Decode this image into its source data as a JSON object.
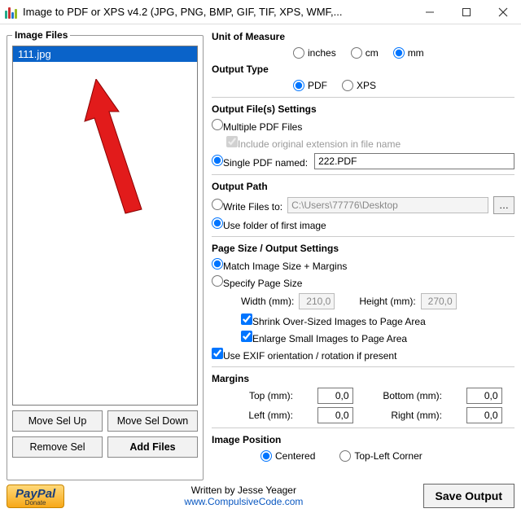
{
  "window": {
    "title": "Image to PDF or XPS  v4.2   (JPG, PNG, BMP, GIF, TIF, XPS, WMF,..."
  },
  "left": {
    "legend": "Image Files",
    "items": [
      "111.jpg"
    ],
    "move_up": "Move Sel Up",
    "move_down": "Move Sel Down",
    "remove": "Remove Sel",
    "add": "Add Files"
  },
  "unit": {
    "legend": "Unit of Measure",
    "inches": "inches",
    "cm": "cm",
    "mm": "mm",
    "selected": "mm"
  },
  "output_type": {
    "legend": "Output Type",
    "pdf": "PDF",
    "xps": "XPS",
    "selected": "PDF"
  },
  "output_files": {
    "legend": "Output File(s) Settings",
    "multiple": "Multiple PDF Files",
    "include_ext": "Include original extension in file name",
    "single": "Single PDF named:",
    "single_value": "222.PDF",
    "selected": "single"
  },
  "output_path": {
    "legend": "Output Path",
    "write_to": "Write Files to:",
    "path_value": "C:\\Users\\77776\\Desktop",
    "use_folder": "Use folder of first image",
    "selected": "use_folder"
  },
  "page_size": {
    "legend": "Page Size / Output Settings",
    "match": "Match Image Size + Margins",
    "specify": "Specify Page Size",
    "selected": "match",
    "width_lbl": "Width (mm):",
    "width_val": "210,0",
    "height_lbl": "Height (mm):",
    "height_val": "270,0",
    "shrink": "Shrink Over-Sized Images to Page Area",
    "enlarge": "Enlarge Small Images to Page Area",
    "exif": "Use EXIF orientation / rotation if present"
  },
  "margins": {
    "legend": "Margins",
    "top_lbl": "Top (mm):",
    "top_val": "0,0",
    "bottom_lbl": "Bottom (mm):",
    "bottom_val": "0,0",
    "left_lbl": "Left (mm):",
    "left_val": "0,0",
    "right_lbl": "Right (mm):",
    "right_val": "0,0"
  },
  "position": {
    "legend": "Image Position",
    "centered": "Centered",
    "topleft": "Top-Left Corner",
    "selected": "centered"
  },
  "footer": {
    "paypal": "PayPal",
    "donate": "Donate",
    "written": "Written by Jesse Yeager",
    "url": "www.CompulsiveCode.com",
    "save": "Save Output"
  }
}
